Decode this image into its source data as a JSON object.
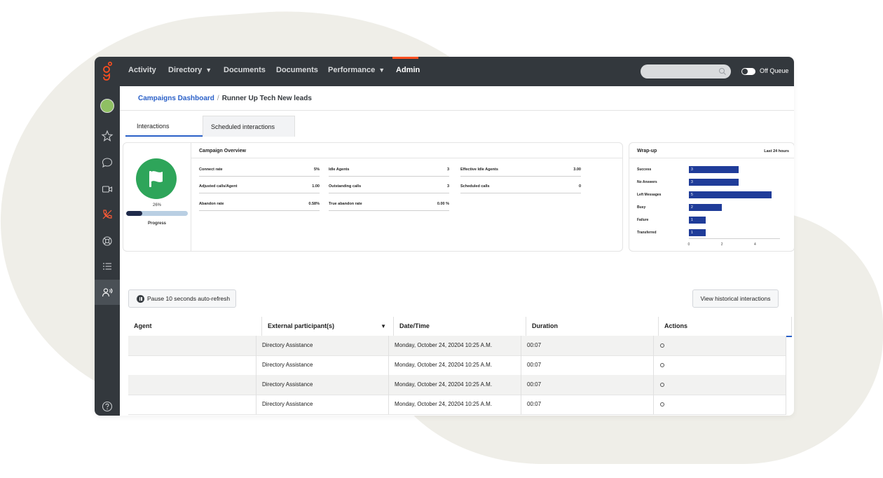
{
  "nav": {
    "items": [
      "Activity",
      "Directory",
      "Documents",
      "Documents",
      "Performance",
      "Admin"
    ],
    "active": "Admin",
    "accent_color": "#ff4f1f"
  },
  "status": {
    "queue_label": "Off Queue",
    "toggle_on": false
  },
  "breadcrumb": {
    "root": "Campaigns Dashboard",
    "separator": "/",
    "current": "Runner Up Tech New leads"
  },
  "tabs": [
    "Interactions",
    "Scheduled interactions"
  ],
  "overview": {
    "title": "Campaign Overview",
    "progress_pct": "26%",
    "progress_value": 0.26,
    "progress_label": "Progress",
    "metrics": [
      {
        "label": "Connect rate",
        "value": "5%"
      },
      {
        "label": "Idle Agents",
        "value": "3"
      },
      {
        "label": "Effective Idle Agents",
        "value": "3.00"
      },
      {
        "label": "Adjusted calls/Agent",
        "value": "1.00"
      },
      {
        "label": "Outstanding calls",
        "value": "3"
      },
      {
        "label": "Scheduled calls",
        "value": "0"
      },
      {
        "label": "Abandon rate",
        "value": "0.58%"
      },
      {
        "label": "True abandon rate",
        "value": "0.00 %"
      }
    ]
  },
  "wrapup": {
    "title": "Wrap-up",
    "range": "Last 24 hours",
    "rows": [
      {
        "label": "Success",
        "value": 3,
        "text": "3"
      },
      {
        "label": "No Answers",
        "value": 3,
        "text": "3"
      },
      {
        "label": "Left Messages",
        "value": 5,
        "text": "5"
      },
      {
        "label": "Busy",
        "value": 2,
        "text": "2"
      },
      {
        "label": "Failure",
        "value": 1,
        "text": "1"
      },
      {
        "label": "Transferred",
        "value": 1,
        "text": "1"
      }
    ],
    "ticks": [
      "0",
      "2",
      "4"
    ],
    "bar_color": "#1f3c99"
  },
  "buttons": {
    "pause": "Pause 10 seconds auto-refresh",
    "history": "View historical interactions"
  },
  "table": {
    "headers": [
      "Agent",
      "External participant(s)",
      "Date/Time",
      "Duration",
      "Actions"
    ],
    "rows": [
      {
        "agent": "",
        "participant": "Directory Assistance",
        "datetime": "Monday, October 24, 20204 10:25 A.M.",
        "duration": "00:07"
      },
      {
        "agent": "",
        "participant": "Directory Assistance",
        "datetime": "Monday, October 24, 20204 10:25 A.M.",
        "duration": "00:07"
      },
      {
        "agent": "",
        "participant": "Directory Assistance",
        "datetime": "Monday, October 24, 20204 10:25 A.M.",
        "duration": "00:07"
      },
      {
        "agent": "",
        "participant": "Directory Assistance",
        "datetime": "Monday, October 24, 20204 10:25 A.M.",
        "duration": "00:07"
      }
    ]
  },
  "sidebar_icons": [
    "avatar",
    "star-icon",
    "chat-icon",
    "video-icon",
    "phone-icon",
    "support-icon",
    "list-icon",
    "people-icon",
    "help-icon"
  ]
}
